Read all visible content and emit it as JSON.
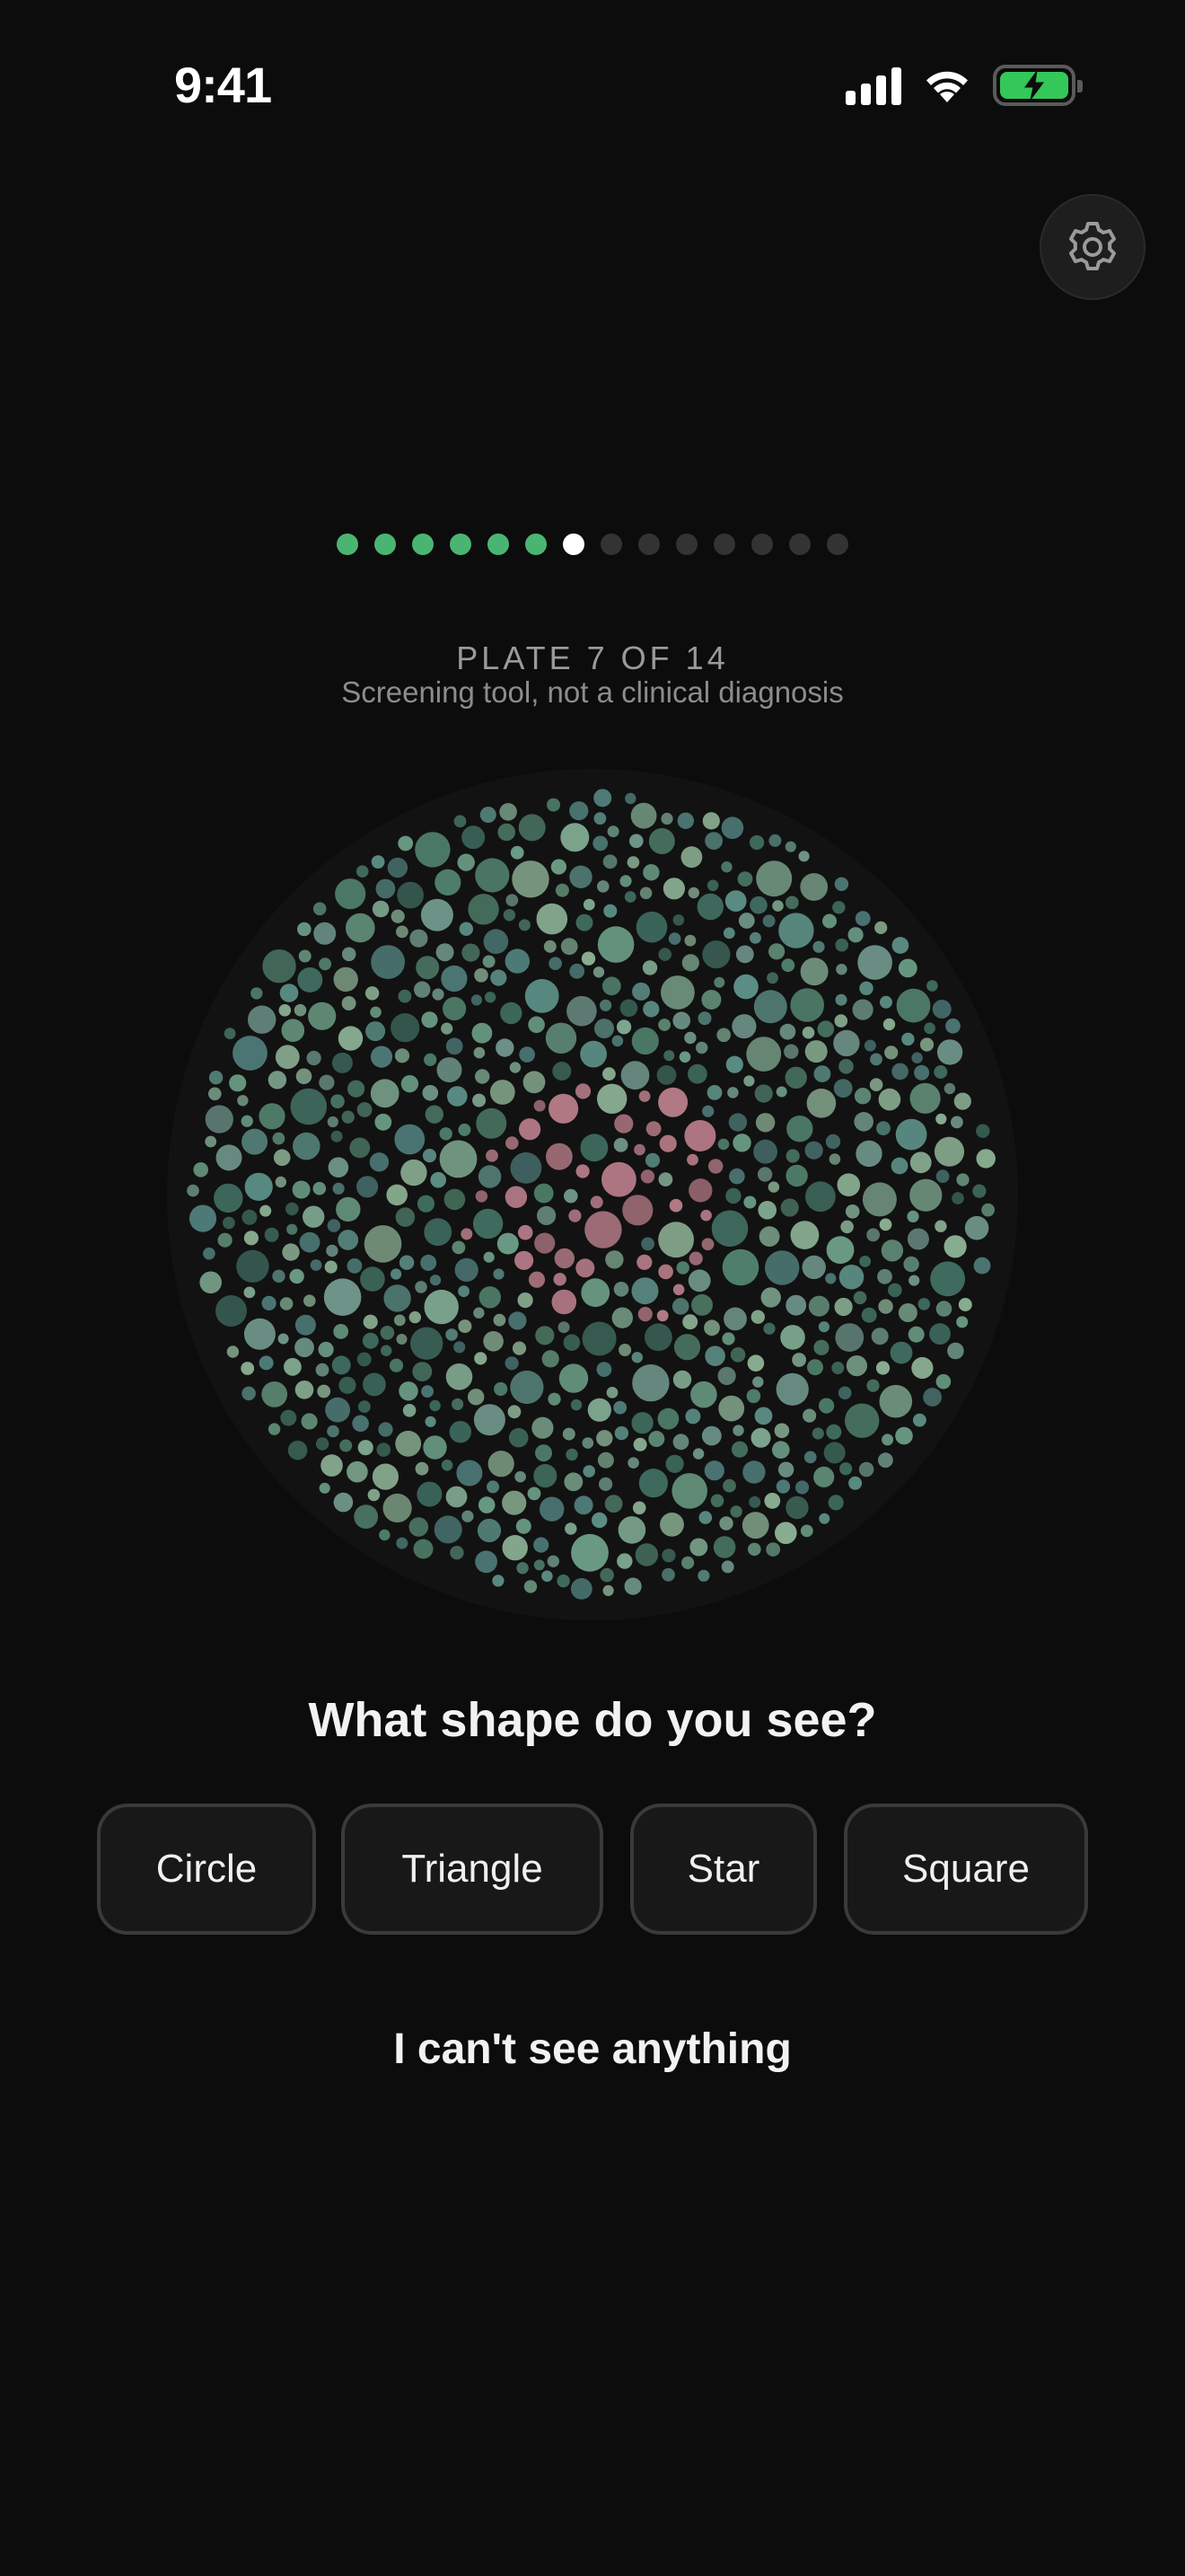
{
  "status_bar": {
    "time": "9:41",
    "signal_icon": "cellular-signal-icon",
    "wifi_icon": "wifi-icon",
    "battery_icon": "battery-charging-icon",
    "battery_color": "#34c759"
  },
  "settings": {
    "icon": "gear-icon"
  },
  "progress": {
    "total": 14,
    "current": 7,
    "completed_color": "#4ab573",
    "current_color": "#ffffff",
    "pending_color": "#333333"
  },
  "plate": {
    "label": "PLATE 7 OF 14",
    "subtitle": "Screening tool, not a clinical diagnosis",
    "figure_color": "#b37a86",
    "background_colors": [
      "#4f7e6a",
      "#6a9b84",
      "#5c8f86",
      "#7da58e",
      "#4e7a78",
      "#8aae92",
      "#3f6b5e",
      "#6f958a"
    ]
  },
  "question": "What shape do you see?",
  "options": [
    "Circle",
    "Triangle",
    "Star",
    "Square"
  ],
  "cant_see": "I can't see anything"
}
